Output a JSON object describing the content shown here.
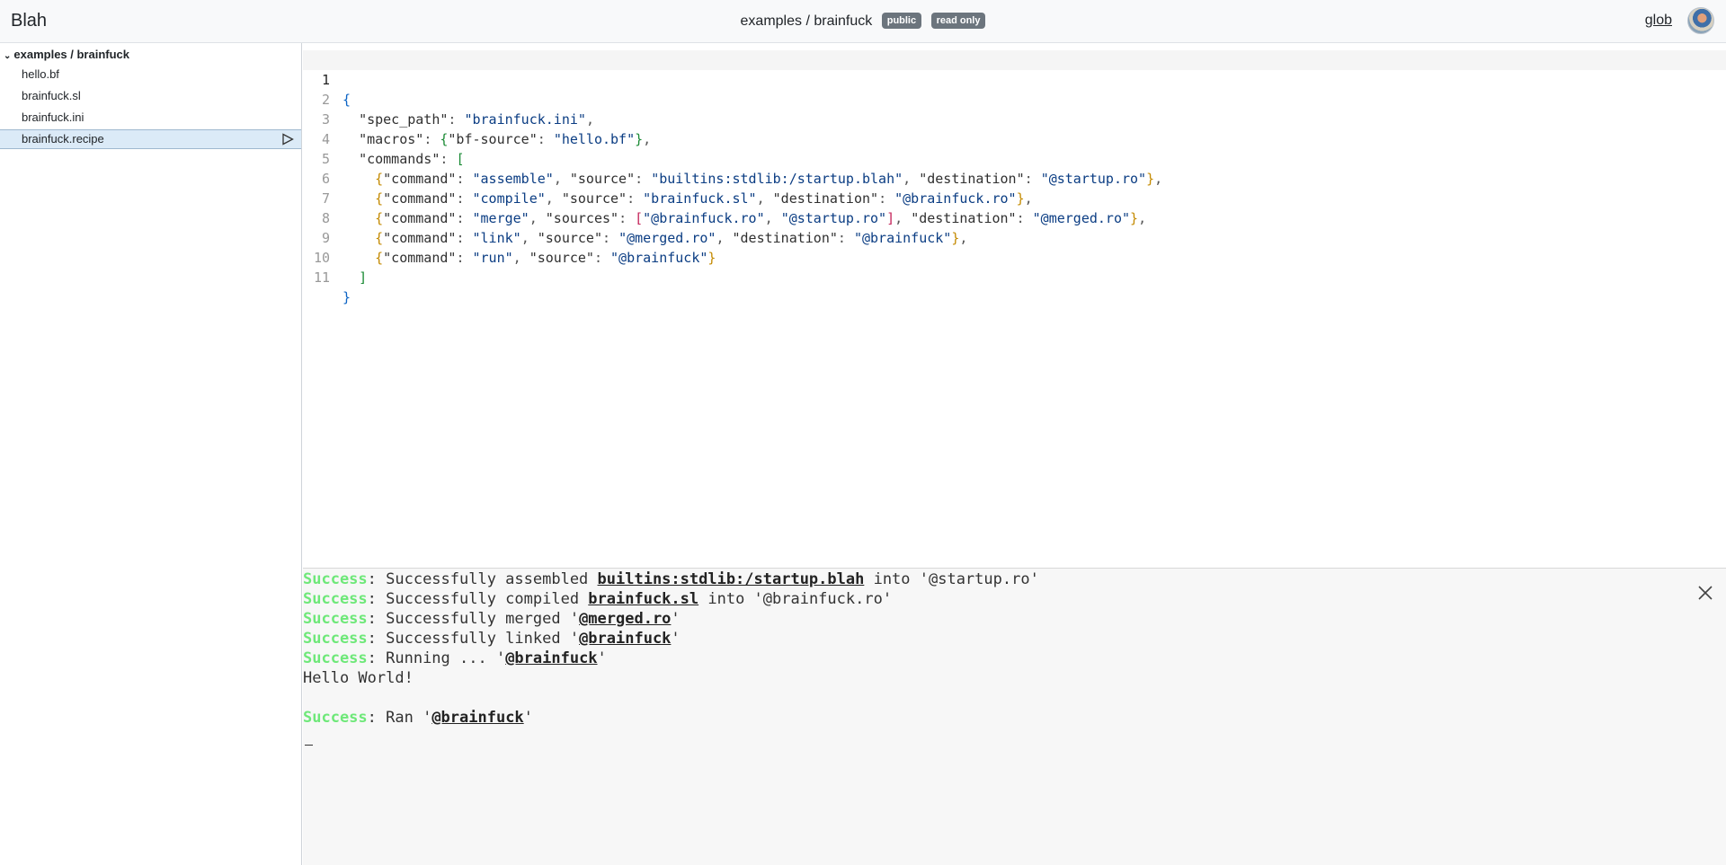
{
  "header": {
    "brand": "Blah",
    "repo_title": "examples / brainfuck",
    "badges": [
      "public",
      "read only"
    ],
    "user": "glob",
    "avatar_icon": "user-avatar"
  },
  "sidebar": {
    "root_label": "examples / brainfuck",
    "files": [
      "hello.bf",
      "brainfuck.sl",
      "brainfuck.ini",
      "brainfuck.recipe"
    ],
    "active_file": "brainfuck.recipe",
    "run_icon": "play-icon"
  },
  "editor": {
    "current_line": 1,
    "line_numbers": [
      "1",
      "2",
      "3",
      "4",
      "5",
      "6",
      "7",
      "8",
      "9",
      "10",
      "11"
    ],
    "tokens": {
      "spec_path_key": "\"spec_path\"",
      "spec_path_val": "\"brainfuck.ini\"",
      "macros_key": "\"macros\"",
      "bf_source_key": "\"bf-source\"",
      "bf_source_val": "\"hello.bf\"",
      "commands_key": "\"commands\"",
      "command_key": "\"command\"",
      "source_key": "\"source\"",
      "sources_key": "\"sources\"",
      "destination_key": "\"destination\"",
      "assemble": "\"assemble\"",
      "startup_blah": "\"builtins:stdlib:/startup.blah\"",
      "startup_ro": "\"@startup.ro\"",
      "compile": "\"compile\"",
      "brainfuck_sl": "\"brainfuck.sl\"",
      "brainfuck_ro": "\"@brainfuck.ro\"",
      "merge": "\"merge\"",
      "merged_ro": "\"@merged.ro\"",
      "link": "\"link\"",
      "brainfuck": "\"@brainfuck\"",
      "run": "\"run\""
    }
  },
  "console": {
    "success": "Success",
    "l1_text": ": Successfully assembled ",
    "l1_ref": "builtins:stdlib:/startup.blah",
    "l1_tail": " into '@startup.ro'",
    "l2_text": ": Successfully compiled ",
    "l2_ref": "brainfuck.sl",
    "l2_tail": " into '@brainfuck.ro'",
    "l3_text": ": Successfully merged '",
    "l3_ref": "@merged.ro",
    "l4_text": ": Successfully linked '",
    "l4_ref": "@brainfuck",
    "l5_text": ": Running ... '",
    "l5_ref": "@brainfuck",
    "output": "Hello World!",
    "l8_text": ": Ran '",
    "l8_ref": "@brainfuck",
    "quote": "'",
    "close_icon": "close-icon"
  },
  "colors": {
    "success": "#6ee879",
    "active_file_bg": "#dbeaf7",
    "badge_bg": "#6c757d",
    "string": "#0b3d83",
    "brace_level1": "#0b63c4",
    "brace_level2": "#1a8a34",
    "brace_level3": "#c48a00",
    "bracket": "#c4245a"
  }
}
